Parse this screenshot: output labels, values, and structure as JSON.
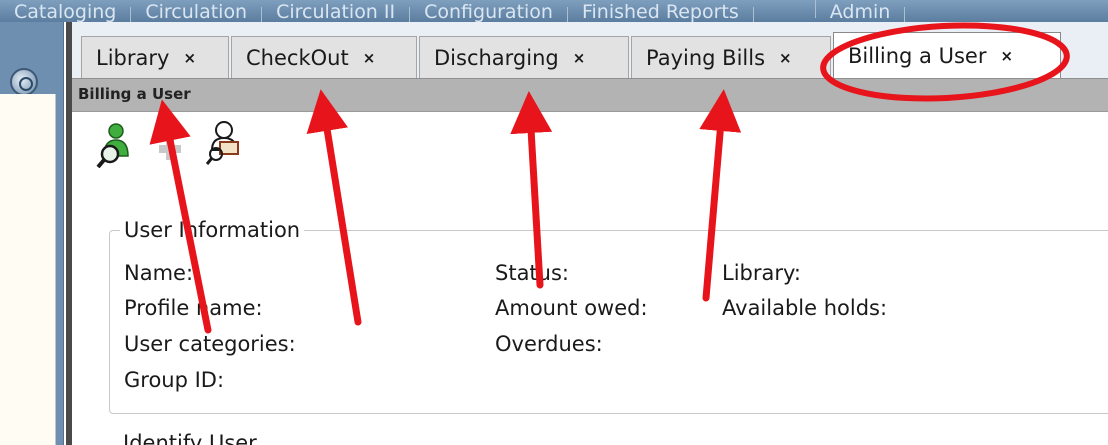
{
  "top_menu": {
    "items": [
      "Cataloging",
      "Circulation",
      "Circulation II",
      "Configuration",
      "Finished Reports",
      "",
      "Admin"
    ]
  },
  "tabs": [
    {
      "label": "Library",
      "close": "×"
    },
    {
      "label": "CheckOut",
      "close": "×"
    },
    {
      "label": "Discharging",
      "close": "×"
    },
    {
      "label": "Paying Bills",
      "close": "×"
    },
    {
      "label": "Billing a User",
      "close": "×",
      "active": true
    }
  ],
  "title_strip": "Billing a User",
  "toolbar": {
    "icons": [
      "user-search-icon",
      "add-icon",
      "user-card-icon"
    ]
  },
  "user_information": {
    "legend": "User Information",
    "col1": [
      "Name:",
      "Profile name:",
      "User categories:",
      "Group ID:"
    ],
    "col2": [
      "Status:",
      "Amount owed:",
      "Overdues:"
    ],
    "col3": [
      "Library:",
      "Available holds:"
    ]
  },
  "identify_user": {
    "legend": "Identify User"
  },
  "colors": {
    "annotation_red": "#e8141b",
    "title_strip_bg": "#b3b3b3",
    "tab_bg": "#e2e2e2",
    "active_tab_bg": "#ffffff",
    "left_frame": "#6f8fb0"
  }
}
